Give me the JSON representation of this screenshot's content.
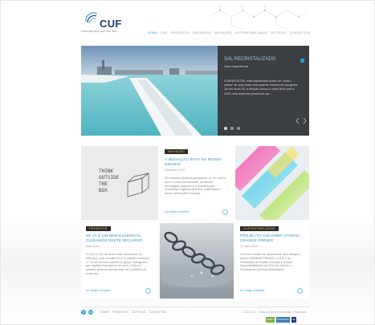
{
  "brand": {
    "name": "CUF",
    "tagline": "Uma química que nos une"
  },
  "nav": {
    "items": [
      "HOME",
      "CUF",
      "PRODUTOS",
      "RECURSOS",
      "INOVAÇÃO",
      "SUSTENTABILIDADE",
      "NOTÍCIAS",
      "CONTACTOS"
    ],
    "active_index": 0
  },
  "hero": {
    "title": "SAL RECRISTALIZADO",
    "subtitle": "Uma experiência",
    "text": "A BENDOSTEK está implantada sobre um \"domo salino\" do qual tiram uma grande reserva de sal-gema. Já nos anos 90, a direção achou a certa linha que a CUF, uma empresa produtora sal...",
    "slides": 3,
    "active_slide": 0
  },
  "cards": {
    "think": {
      "lines": [
        "THINK",
        "OUTSIDE",
        "THE",
        "BOX"
      ]
    },
    "innovation": {
      "tag": "INOVAÇÃO",
      "title": "A INOVAÇÃO ESTÁ NA NOSSA ORIGEM",
      "date": "Dezembro 2013",
      "text": "Da Indústria Química portuguesa, há um marco que é o início de inovação, na direção tecnológica original e é a resposta pela Sociedade Orgânica Química, sustentável e eficaz, fabricação e energia...",
      "more": "ver artigo completo"
    },
    "products": {
      "tag": "PRODUTOS",
      "title": "SE JÁ É UM BEM ESSENCIAL, CUIDAMOS DESTE RECURSO",
      "date": "Maio 2013",
      "text": "A Cloro é um elemento muito abundante na Natureza, pois constitui 2% e é contido e extraído 1.° 10 em termos maiores no grupo \"Halogéneo\", que significa formadores de sal e a Cloro é também geral ao sal minerais, há condições de produção...",
      "more": "ver artigo completo"
    },
    "sustainability": {
      "tag": "SUSTENTABILIDADE",
      "title": "PROJECTO COLOMBO ATINGIU GRANDE PRÉMIO",
      "date": "17 Julho 2013",
      "text": "Um novo modelo de auditoria de risco atingiu o prémio GRANDE PRÉMIO, a CUF e as Fundações de Gestão, Direção e Gestão responsabilidades do 2013 da Jovens e Produtos de Química Sustentável...",
      "more": "ver artigo completo"
    }
  },
  "footer": {
    "links": [
      "HOME",
      "PRODUTOS",
      "NOTÍCIAS",
      "CONTACTOS"
    ],
    "copyright": "© 2013 CUF - Todos os direitos reservados · Privacidade",
    "badges": [
      "QREN",
      "COMPETE",
      "UE"
    ]
  },
  "colors": {
    "accent": "#2ea7dc",
    "tag_bg": "#2c2c2c",
    "tag_text": "#f3c24a",
    "hero_panel": "#3c3f42"
  }
}
